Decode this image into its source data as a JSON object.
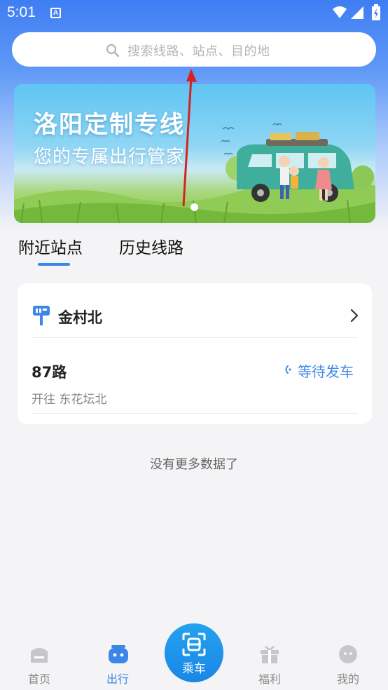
{
  "status_bar": {
    "time": "5:01",
    "notification_icon": "a-icon",
    "icons": [
      "wifi-icon",
      "signal-icon",
      "battery-icon"
    ]
  },
  "search": {
    "placeholder": "搜索线路、站点、目的地",
    "icon": "search-icon"
  },
  "banner": {
    "title": "洛阳定制专线",
    "subtitle": "您的专属出行管家"
  },
  "tabs": {
    "items": [
      {
        "label": "附近站点",
        "active": true
      },
      {
        "label": "历史线路",
        "active": false
      }
    ],
    "accent": "#3b86e8"
  },
  "stop_card": {
    "stop_name": "金村北",
    "route": "87路",
    "destination": "开往 东花坛北",
    "status": "等待发车",
    "status_color": "#3f8ae8"
  },
  "no_more": "没有更多数据了",
  "bottom_nav": {
    "items": [
      {
        "label": "首页",
        "icon": "home-icon",
        "active": false
      },
      {
        "label": "出行",
        "icon": "bus-icon",
        "active": true
      },
      {
        "label": "乘车",
        "icon": "scan-icon",
        "active": false
      },
      {
        "label": "福利",
        "icon": "gift-icon",
        "active": false
      },
      {
        "label": "我的",
        "icon": "face-icon",
        "active": false
      }
    ]
  },
  "colors": {
    "header_blue": "#3f7ef3",
    "active_blue": "#3b86e8",
    "ride_button": "#1a86e6",
    "annotation_arrow": "#d62222"
  }
}
